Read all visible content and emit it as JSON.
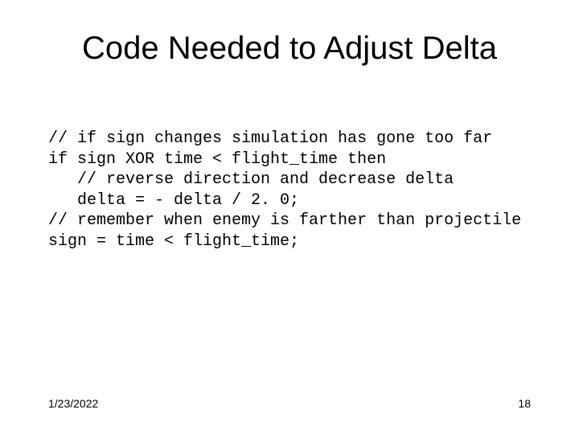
{
  "title": "Code Needed to Adjust Delta",
  "code": {
    "l1": "// if sign changes simulation has gone too far",
    "l2": "if sign XOR time < flight_time then",
    "l3": "   // reverse direction and decrease delta",
    "l4": "   delta = - delta / 2. 0;",
    "l5": "// remember when enemy is farther than projectile",
    "l6": "sign = time < flight_time;"
  },
  "footer": {
    "date": "1/23/2022",
    "page": "18"
  }
}
